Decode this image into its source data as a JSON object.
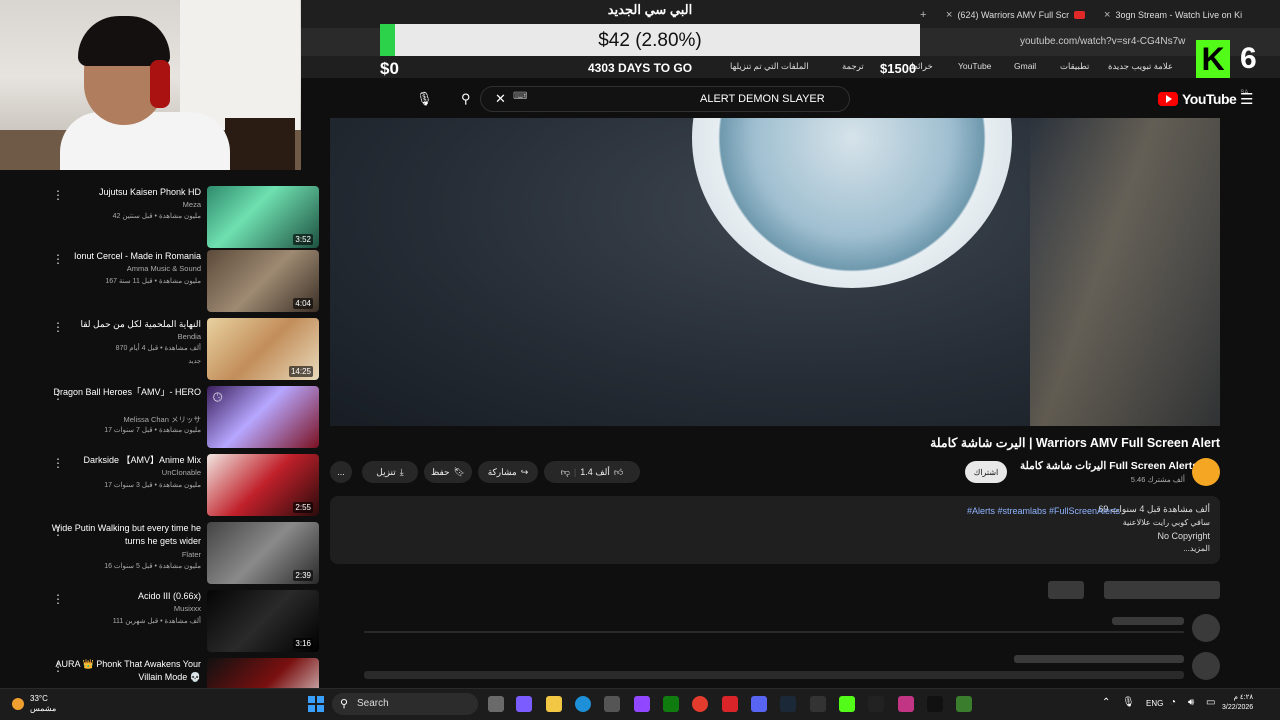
{
  "browser": {
    "tabs": [
      {
        "label": "(624) Warriors AMV Full Scr"
      },
      {
        "label": "3ogn Stream - Watch Live on Ki"
      }
    ],
    "url": "youtube.com/watch?v=sr4-CG4Ns7w",
    "bookmarks": [
      "علامة تبويب جديدة",
      "تطبيقات",
      "Gmail",
      "YouTube",
      "خرائط",
      "ترجمة",
      "الملفات التي تم تنزيلها"
    ]
  },
  "overlay": {
    "title": "البي سي الجديد",
    "goal_text": "$42 (2.80%)",
    "goal_progress": 0.028,
    "goal_start": "$0",
    "goal_end": "$1500",
    "days_left": "4303 DAYS TO GO",
    "kick_count": "6",
    "colors": {
      "fill": "#2bd24a",
      "kick": "#53fc18"
    }
  },
  "youtube": {
    "search_query": "ALERT DEMON SLAYER",
    "logo_word": "YouTube",
    "logo_country": "SA",
    "video": {
      "title": "اليرت شاشة كاملة | Warriors AMV Full Screen Alert",
      "channel": "اليرتات شاشة كاملة Full Screen Alerts ||",
      "subs": "5.46 ألف مشترك",
      "subscribe": "اشتراك",
      "likes": "1.4 ألف",
      "share": "مشاركة",
      "save": "حفظ",
      "download": "تنزيل",
      "more": "..."
    },
    "description": {
      "stats": "69 ألف مشاهدة قبل 4 سنوات",
      "tags": "#Alerts #streamlabs #FullScreenAlerts",
      "line2": "سافي كوبي رايت علالاعنية",
      "line3": "No Copyright",
      "more": "...المزيد"
    },
    "recommendations": [
      {
        "title": "Jujutsu Kaisen Phonk HD",
        "channel": "Meza",
        "meta": "42 مليون مشاهدة • قبل سنتين",
        "duration": "3:52"
      },
      {
        "title": "Ionut Cercel - Made in Romania",
        "channel": "Amma Music & Sound",
        "meta": "167 مليون مشاهدة • قبل 11 سنة",
        "duration": "4:04"
      },
      {
        "title": "النهاية الملحمية لكل من حمل لقا",
        "channel": "Bendia",
        "meta": "870 ألف مشاهدة • قبل 4 أيام",
        "duration": "14:25",
        "badge": "جديد"
      },
      {
        "title": "Dragon Ball Heroes「AMV」- HERO",
        "channel": "Melissa Chan メリッサ",
        "meta": "17 مليون مشاهدة • قبل 7 سنوات",
        "duration": ""
      },
      {
        "title": "Darkside 【AMV】Anime Mix",
        "channel": "UnClonable",
        "meta": "17 مليون مشاهدة • قبل 3 سنوات",
        "duration": "2:55"
      },
      {
        "title": "Wide Putin Walking but every time he turns he gets wider",
        "channel": "Flater",
        "meta": "16 مليون مشاهدة • قبل 5 سنوات",
        "duration": "2:39"
      },
      {
        "title": "Acido III (0.66x)",
        "channel": "Musixxx",
        "meta": "111 ألف مشاهدة • قبل شهرين",
        "duration": "3:16"
      },
      {
        "title": "AURA 👑 Phonk That Awakens Your Villain Mode 💀",
        "channel": "",
        "meta": "",
        "duration": ""
      }
    ]
  },
  "taskbar": {
    "weather_temp": "33°C",
    "weather_desc": "مشمس",
    "search": "Search",
    "lang": "ENG",
    "time": "٤:٢٨ م",
    "date": "3/22/2026"
  }
}
